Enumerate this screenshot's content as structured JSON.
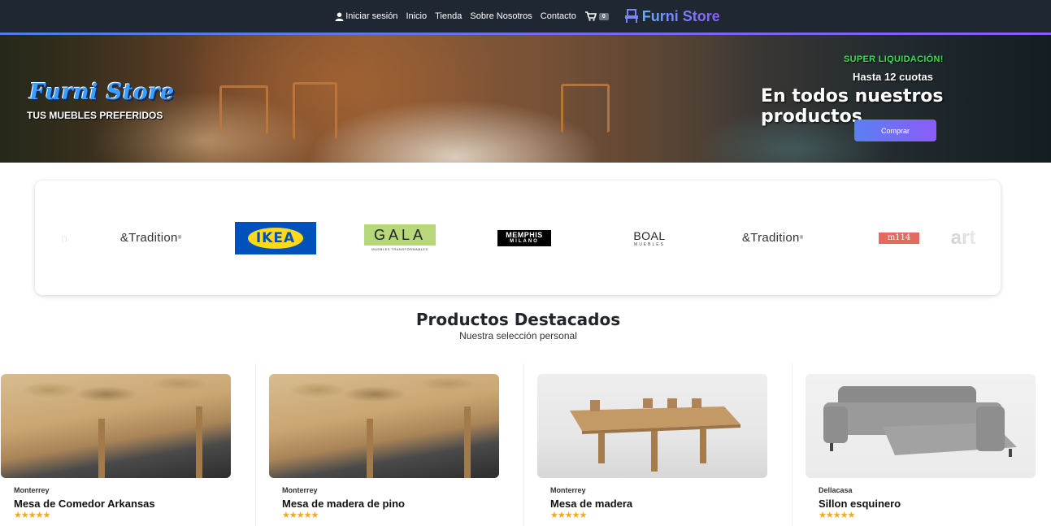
{
  "nav": {
    "login": "Iniciar sesión",
    "links": [
      "Inicio",
      "Tienda",
      "Sobre Nosotros",
      "Contacto"
    ],
    "cart_count": "0",
    "brand": "Furni Store"
  },
  "hero": {
    "logo": "Furni Store",
    "tagline": "TUS MUEBLES PREFERIDOS",
    "promo_super": "SUPER LIQUIDACIÓN!",
    "promo_cuotas": "Hasta 12 cuotas",
    "promo_main": "En todos nuestros productos",
    "cta": "Comprar"
  },
  "brands": {
    "tradition": "&Tradition",
    "ikea": "IKEA",
    "gala": "GALA",
    "gala_sub": "MUEBLES TRANSFORMABLES",
    "memphis": "MEMPHIS",
    "memphis_sub": "MILANO",
    "boal": "BOAL",
    "boal_sub": "MUEBLES",
    "m114": "m114",
    "arte": "art",
    "frag": "n"
  },
  "section": {
    "title": "Productos Destacados",
    "subtitle": "Nuestra selección personal"
  },
  "products": [
    {
      "brand": "Monterrey",
      "name": "Mesa de Comedor Arkansas",
      "stars": "★★★★★"
    },
    {
      "brand": "Monterrey",
      "name": "Mesa de madera de pino",
      "stars": "★★★★★"
    },
    {
      "brand": "Monterrey",
      "name": "Mesa de madera",
      "stars": "★★★★★"
    },
    {
      "brand": "Dellacasa",
      "name": "Sillon esquinero",
      "stars": "★★★★★"
    }
  ],
  "colors": {
    "navbar": "#1f2733",
    "accent_start": "#5b7ff2",
    "accent_end": "#8b5cf6",
    "promo_green": "#37e04d",
    "star": "#f5a623"
  }
}
